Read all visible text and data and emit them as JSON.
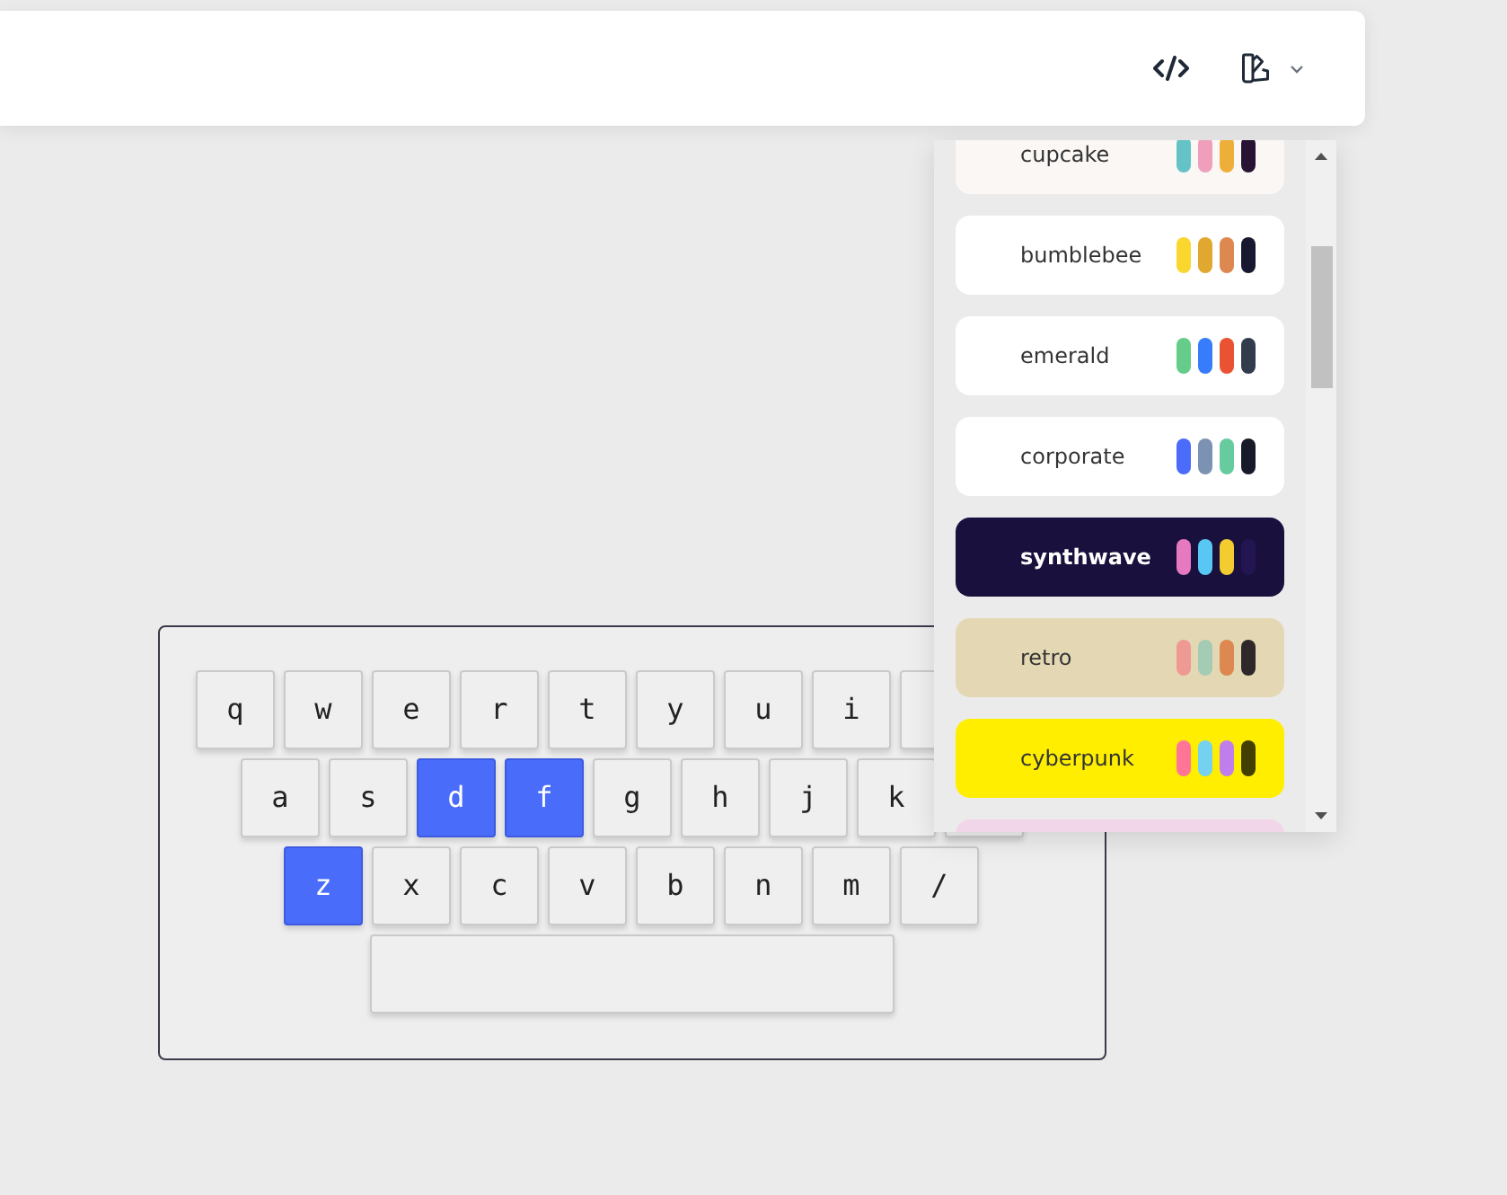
{
  "theme_menu": {
    "items": [
      {
        "name": "cupcake",
        "color": "#faf7f5",
        "swatches": [
          {
            "color": "#65c3c8"
          },
          {
            "color": "#ef9fbc"
          },
          {
            "color": "#eeaf3a"
          },
          {
            "color": "#291334"
          }
        ]
      },
      {
        "name": "bumblebee",
        "color": "#ffffff",
        "swatches": [
          {
            "color": "#f9d72f"
          },
          {
            "color": "#e0a82e"
          },
          {
            "color": "#dc8850"
          },
          {
            "color": "#181830"
          }
        ]
      },
      {
        "name": "emerald",
        "color": "#ffffff",
        "swatches": [
          {
            "color": "#66cc8a"
          },
          {
            "color": "#377cfb"
          },
          {
            "color": "#ea5234"
          },
          {
            "color": "#333c4d"
          }
        ]
      },
      {
        "name": "corporate",
        "color": "#ffffff",
        "swatches": [
          {
            "color": "#4b6bfb"
          },
          {
            "color": "#7b92b2"
          },
          {
            "color": "#67cba0"
          },
          {
            "color": "#181a2a"
          }
        ]
      },
      {
        "name": "synthwave",
        "color": "#1a103d",
        "swatches": [
          {
            "color": "#e779c1"
          },
          {
            "color": "#58c7f3"
          },
          {
            "color": "#f3cc30"
          },
          {
            "color": "#221551"
          }
        ]
      },
      {
        "name": "retro",
        "color": "#e4d8b4",
        "swatches": [
          {
            "color": "#ef9995"
          },
          {
            "color": "#a4cbb4"
          },
          {
            "color": "#dc8850"
          },
          {
            "color": "#2e282a"
          }
        ]
      },
      {
        "name": "cyberpunk",
        "color": "#ffee00",
        "swatches": [
          {
            "color": "#ff7598"
          },
          {
            "color": "#75d1f0"
          },
          {
            "color": "#c07eec"
          },
          {
            "color": "#423f00"
          }
        ]
      },
      {
        "color": "#f0d6e8"
      }
    ]
  },
  "keyboard": {
    "rows": [
      [
        {
          "label": "q",
          "selected": false
        },
        {
          "label": "w",
          "selected": false
        },
        {
          "label": "e",
          "selected": false
        },
        {
          "label": "r",
          "selected": false
        },
        {
          "label": "t",
          "selected": false
        },
        {
          "label": "y",
          "selected": false
        },
        {
          "label": "u",
          "selected": false
        },
        {
          "label": "i",
          "selected": false
        },
        {
          "selected": false
        }
      ],
      [
        {
          "label": "a",
          "selected": false
        },
        {
          "label": "s",
          "selected": false
        },
        {
          "label": "d",
          "selected": true
        },
        {
          "label": "f",
          "selected": true
        },
        {
          "label": "g",
          "selected": false
        },
        {
          "label": "h",
          "selected": false
        },
        {
          "label": "j",
          "selected": false
        },
        {
          "label": "k",
          "selected": false
        },
        {
          "selected": false
        }
      ],
      [
        {
          "label": "z",
          "selected": true
        },
        {
          "label": "x",
          "selected": false
        },
        {
          "label": "c",
          "selected": false
        },
        {
          "label": "v",
          "selected": false
        },
        {
          "label": "b",
          "selected": false
        },
        {
          "label": "n",
          "selected": false
        },
        {
          "label": "m",
          "selected": false
        },
        {
          "label": "/",
          "selected": false
        }
      ]
    ],
    "space_bar": {
      "selected": false
    }
  }
}
